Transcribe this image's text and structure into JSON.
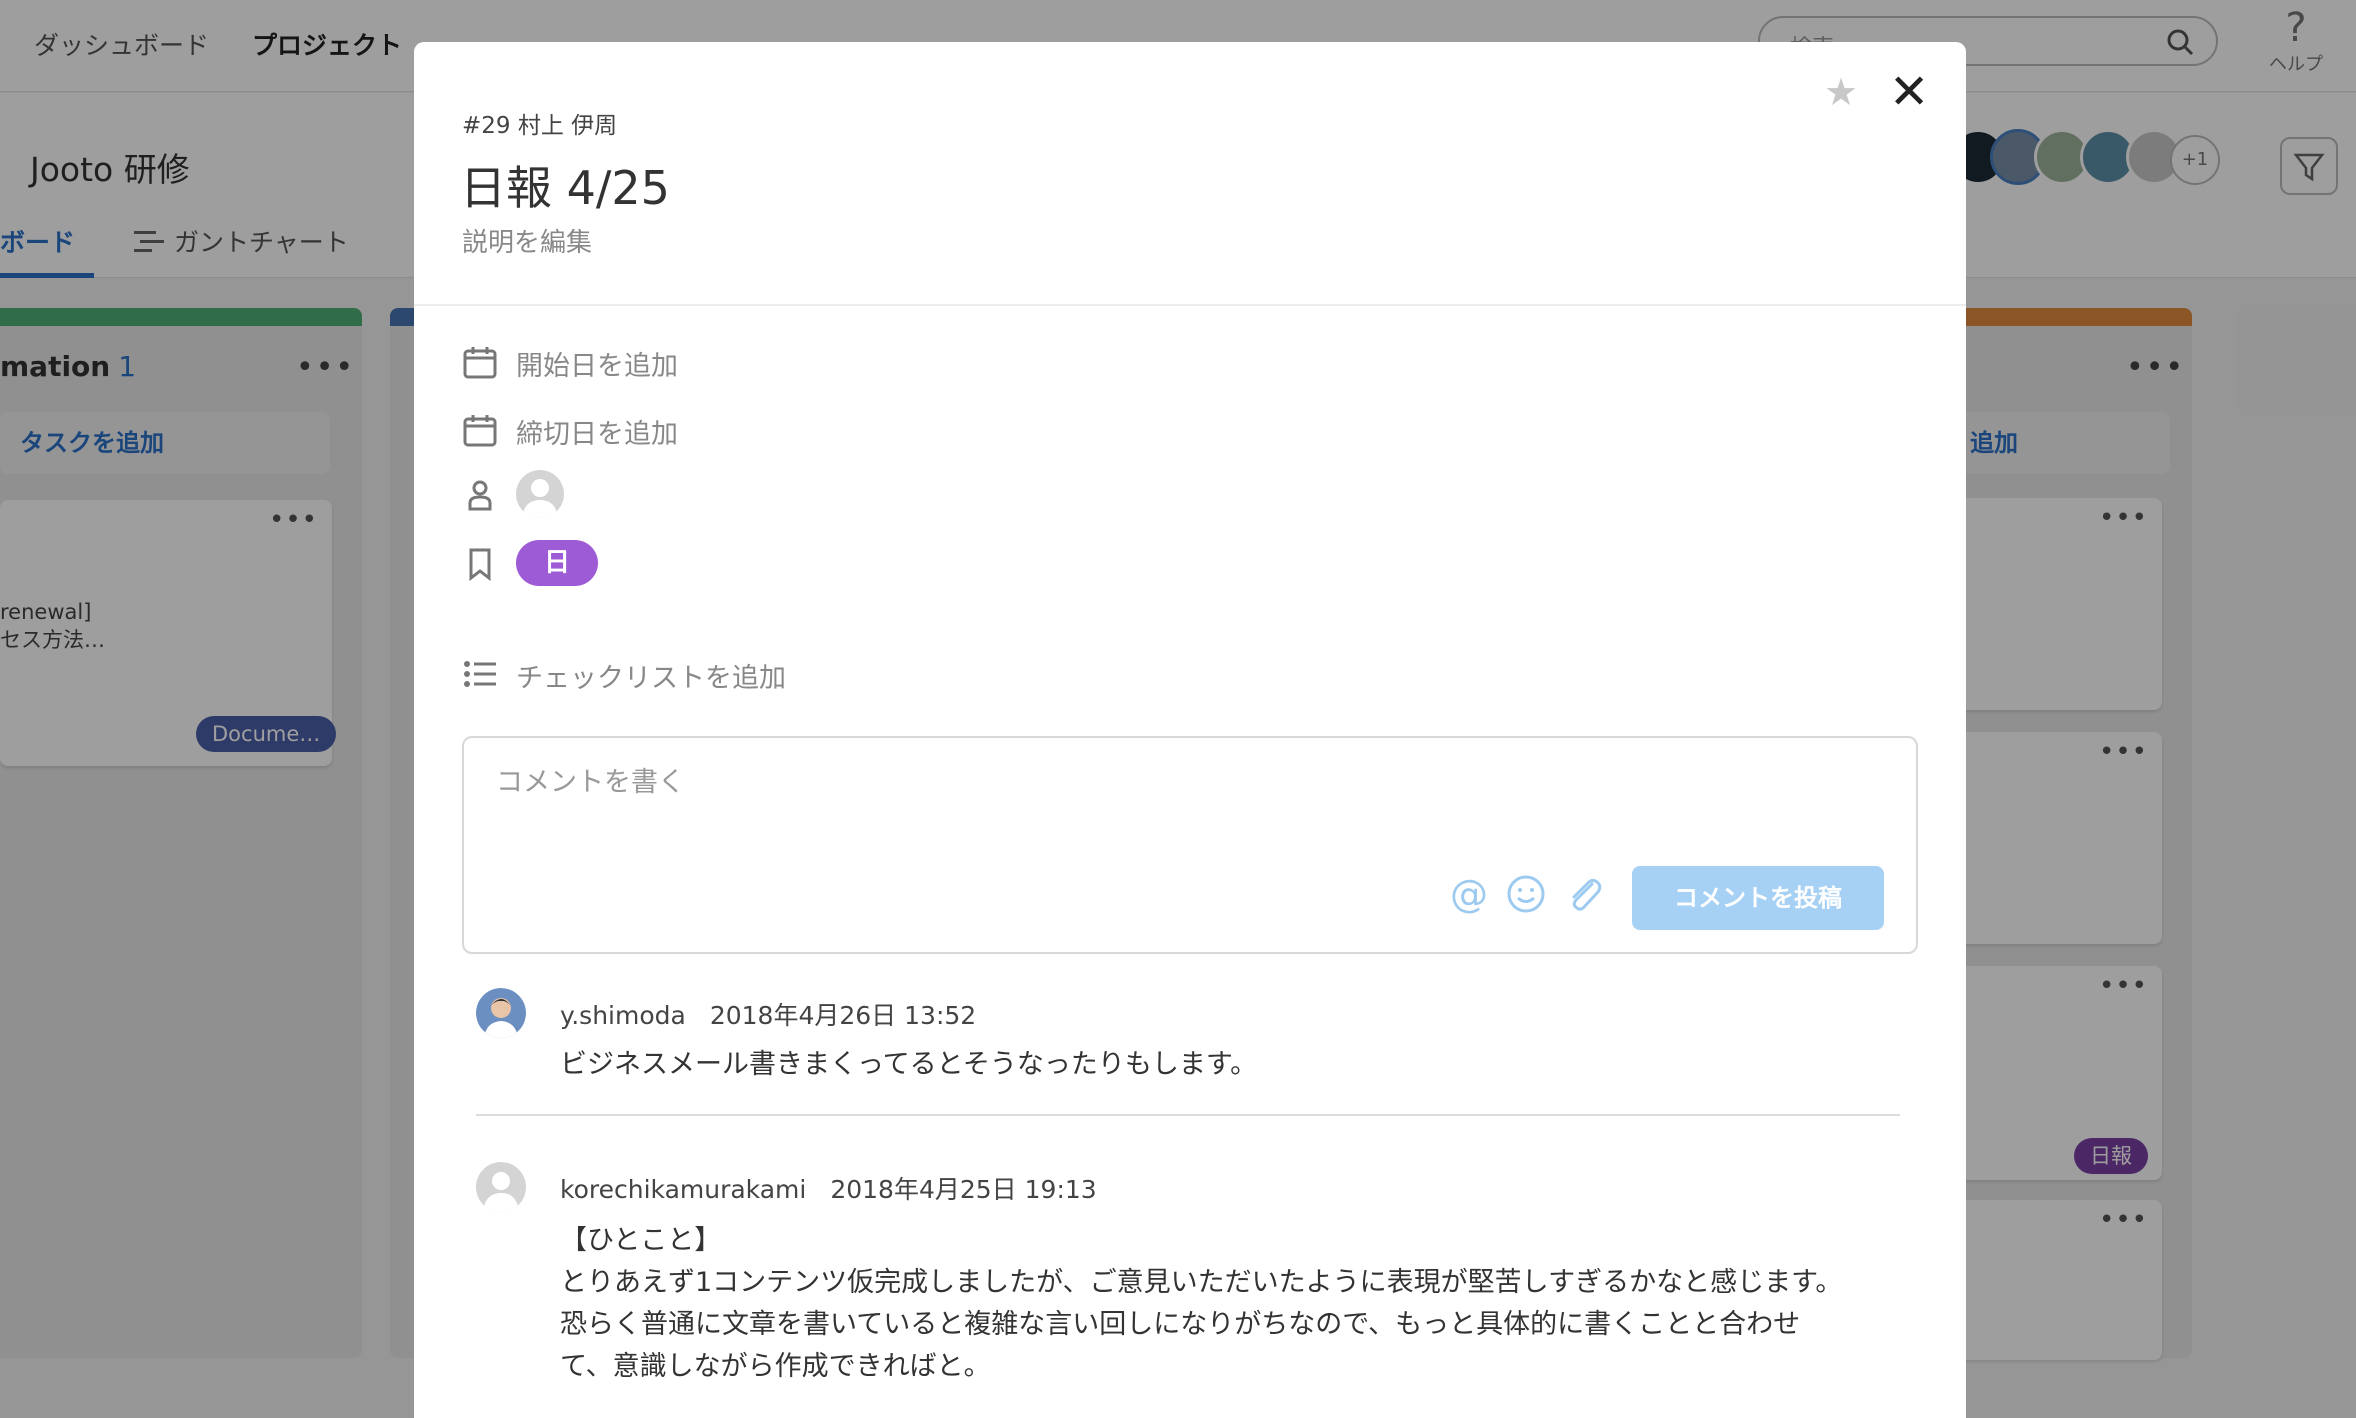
{
  "topnav": {
    "items": [
      "ダッシュボード",
      "プロジェクト"
    ],
    "search_placeholder": "検索",
    "help_label": "ヘルプ",
    "help_glyph": "?"
  },
  "project": {
    "title": "Jooto 研修",
    "tabs": [
      "ボード",
      "ガントチャート"
    ],
    "members_more": "+1"
  },
  "board": {
    "left_column": {
      "title": "mation",
      "count": "1",
      "add_task": "タスクを追加",
      "card_text": [
        "renewal]",
        "セス方法…"
      ],
      "card_tag": "Docume…",
      "bar_color": "#4caf73"
    },
    "right_column": {
      "add_task_partial": "追加",
      "card_tag": "日報",
      "bar_color": "#e08a3c"
    }
  },
  "modal": {
    "meta": "#29 村上 伊周",
    "title": "日報 4/25",
    "description_link": "説明を編集",
    "start_date": "開始日を追加",
    "due_date": "締切日を追加",
    "label": "日報",
    "checklist": "チェックリストを追加",
    "comment_placeholder": "コメントを書く",
    "post_button": "コメントを投稿",
    "mention_glyph": "@",
    "comments": [
      {
        "user": "y.shimoda",
        "time": "2018年4月26日 13:52",
        "body": "ビジネスメール書きまくってるとそうなったりもします。"
      },
      {
        "user": "korechikamurakami",
        "time": "2018年4月25日 19:13",
        "lines": [
          "【ひとこと】",
          "とりあえず1コンテンツ仮完成しましたが、ご意見いただいたように表現が堅苦しすぎるかなと感じます。",
          "恐らく普通に文章を書いていると複雑な言い回しになりがちなので、もっと具体的に書くことと合わせ",
          "て、意識しながら作成できればと。"
        ]
      }
    ]
  },
  "colors": {
    "accent": "#2b72c9",
    "label_purple": "#9e5bd6",
    "post_button": "#a7d1f4"
  }
}
